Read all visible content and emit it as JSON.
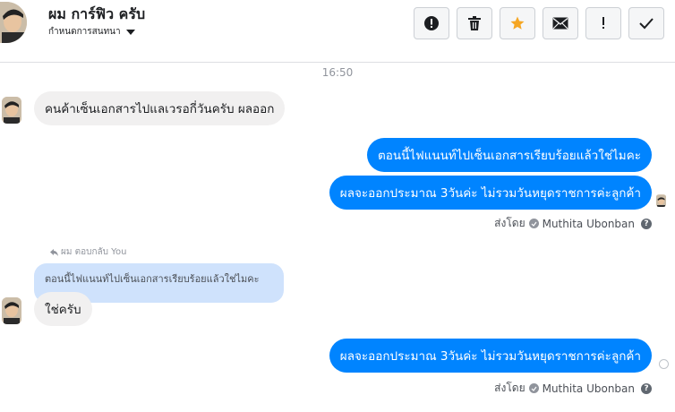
{
  "header": {
    "contact_name": "ผม การ์ฟิว ครับ",
    "contact_subtitle": "กำหนดการสนทนา",
    "actions": [
      {
        "name": "warning-button",
        "icon": "exclamation-circle-icon",
        "label": "!"
      },
      {
        "name": "delete-button",
        "icon": "trash-icon"
      },
      {
        "name": "star-button",
        "icon": "star-icon",
        "color": "#f5a623"
      },
      {
        "name": "mark-unread-button",
        "icon": "envelope-icon"
      },
      {
        "name": "important-button",
        "icon": "exclamation-icon",
        "label": "!"
      },
      {
        "name": "done-button",
        "icon": "checkmark-icon"
      }
    ]
  },
  "conversation": {
    "timestamp": "16:50",
    "messages": [
      {
        "from": "customer",
        "text": "คนค้าเซ็นเอกสารไปแลเวรอกี่วันครับ ผลออก"
      },
      {
        "from": "page",
        "text": "ตอนนี้ไฟแนนท์ไปเซ็นเอกสารเรียบร้อยแล้วใช่ไมคะ"
      },
      {
        "from": "page",
        "text": "ผลจะออกประมาณ 3วันค่ะ ไม่รวมวันหยุดราชการค่ะลูกค้า"
      },
      {
        "from": "customer",
        "text": "ใช่ครับ"
      },
      {
        "from": "page",
        "text": "ผลจะออกประมาณ 3วันค่ะ ไม่รวมวันหยุดราชการค่ะลูกค้า"
      }
    ],
    "sent_by_prefix": "ส่งโดย",
    "sent_by_name": "Muthita Ubonban",
    "help_glyph": "?",
    "reply_label": "ผม ตอบกลับ You",
    "quoted_text": "ตอนนี้ไฟแนนท์ไปเซ็นเอกสารเรียบร้อยแล้วใช่ไมคะ"
  },
  "colors": {
    "outgoing_bubble": "#0084ff",
    "incoming_bubble": "#f1f0f0",
    "quote_bubble": "#cfe2fc",
    "star": "#f5a623"
  }
}
